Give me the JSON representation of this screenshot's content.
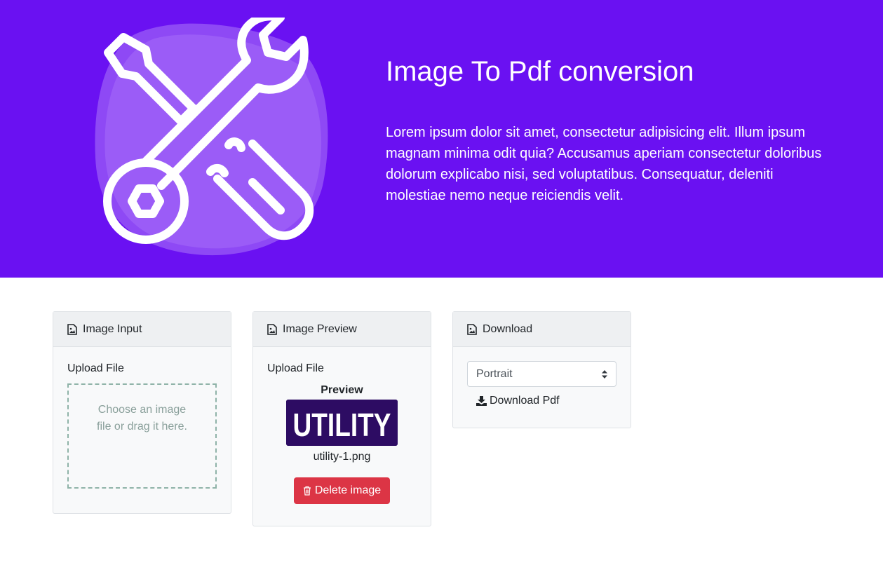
{
  "hero": {
    "title": "Image To Pdf conversion",
    "description": "Lorem ipsum dolor sit amet, consectetur adipisicing elit. Illum ipsum magnam minima odit quia? Accusamus aperiam consectetur doloribus dolorum explicabo nisi, sed voluptatibus. Consequatur, deleniti molestiae nemo neque reiciendis velit.",
    "illustration_icon": "tools-icon",
    "background_color": "#6a11f2"
  },
  "input_card": {
    "title": "Image Input",
    "icon": "image-file-icon",
    "upload_label": "Upload File",
    "dropzone_text": "Choose an image file or drag it here."
  },
  "preview_card": {
    "title": "Image Preview",
    "icon": "image-file-icon",
    "upload_label": "Upload File",
    "preview_heading": "Preview",
    "thumbnail_text": "UTILITY",
    "filename": "utility-1.png",
    "delete_label": "Delete image",
    "delete_icon": "trash-icon",
    "delete_color": "#dc3545"
  },
  "download_card": {
    "title": "Download",
    "icon": "image-file-icon",
    "orientation_selected": "Portrait",
    "download_label": "Download Pdf",
    "download_icon": "download-icon"
  }
}
